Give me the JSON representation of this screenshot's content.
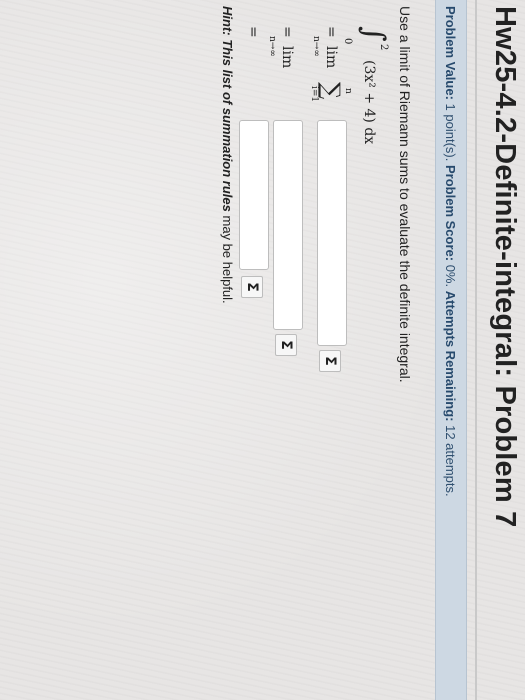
{
  "header": {
    "title": "Hw25-4.2-Definite-integral: Problem 7"
  },
  "info": {
    "problem_value_label": "Problem Value:",
    "problem_value": "1 point(s).",
    "problem_score_label": "Problem Score:",
    "problem_score": "0%.",
    "attempts_label": "Attempts Remaining:",
    "attempts": "12 attempts."
  },
  "question": {
    "text": "Use a limit of Riemann sums to evaluate the definite integral."
  },
  "math": {
    "integral_upper": "2",
    "integral_lower": "0",
    "integrand": "(3x² + 4) dx",
    "eq": "=",
    "lim": "lim",
    "lim_sub": "n→∞",
    "sum_symbol": "∑",
    "sum_upper": "n",
    "sum_lower": "i=1"
  },
  "inputs": {
    "sigma_label": "Σ"
  },
  "hint": {
    "prefix": "Hint:",
    "link": "This list of summation rules",
    "suffix": "may be helpful."
  }
}
